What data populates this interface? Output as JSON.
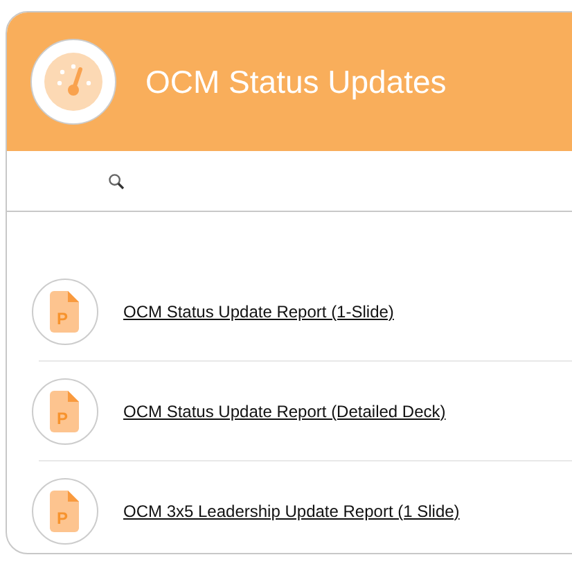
{
  "header": {
    "title": "OCM Status Updates"
  },
  "documents": [
    {
      "title": "OCM Status Update Report (1-Slide)",
      "icon_letter": "P"
    },
    {
      "title": "OCM Status Update Report (Detailed Deck)",
      "icon_letter": "P"
    },
    {
      "title": "OCM 3x5 Leadership Update Report (1 Slide)",
      "icon_letter": "P"
    }
  ]
}
